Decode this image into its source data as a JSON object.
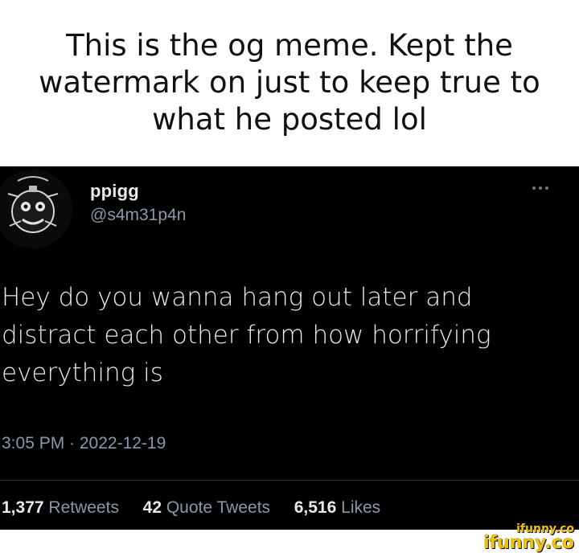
{
  "caption": {
    "text": "This is the og meme. Kept the watermark on just to keep true to what he posted lol"
  },
  "tweet": {
    "display_name": "ppigg",
    "handle": "@s4m31p4n",
    "body": "Hey do you wanna hang out later and distract each other from how horrifying everything is",
    "timestamp": "3:05 PM · 2022-12-19",
    "stats": {
      "retweets_count": "1,377",
      "retweets_label": "Retweets",
      "quotes_count": "42",
      "quotes_label": "Quote Tweets",
      "likes_count": "6,516",
      "likes_label": "Likes"
    },
    "icons": {
      "avatar": "avatar-image",
      "more": "more-horizontal-icon"
    }
  },
  "watermark": {
    "small_text": "ifunny.co",
    "large_text": "ifunny.co"
  },
  "colors": {
    "tweet_background": "#000000",
    "primary_text": "#e7e9ea",
    "secondary_text": "#8b98a5",
    "watermark": "#f2c200"
  }
}
